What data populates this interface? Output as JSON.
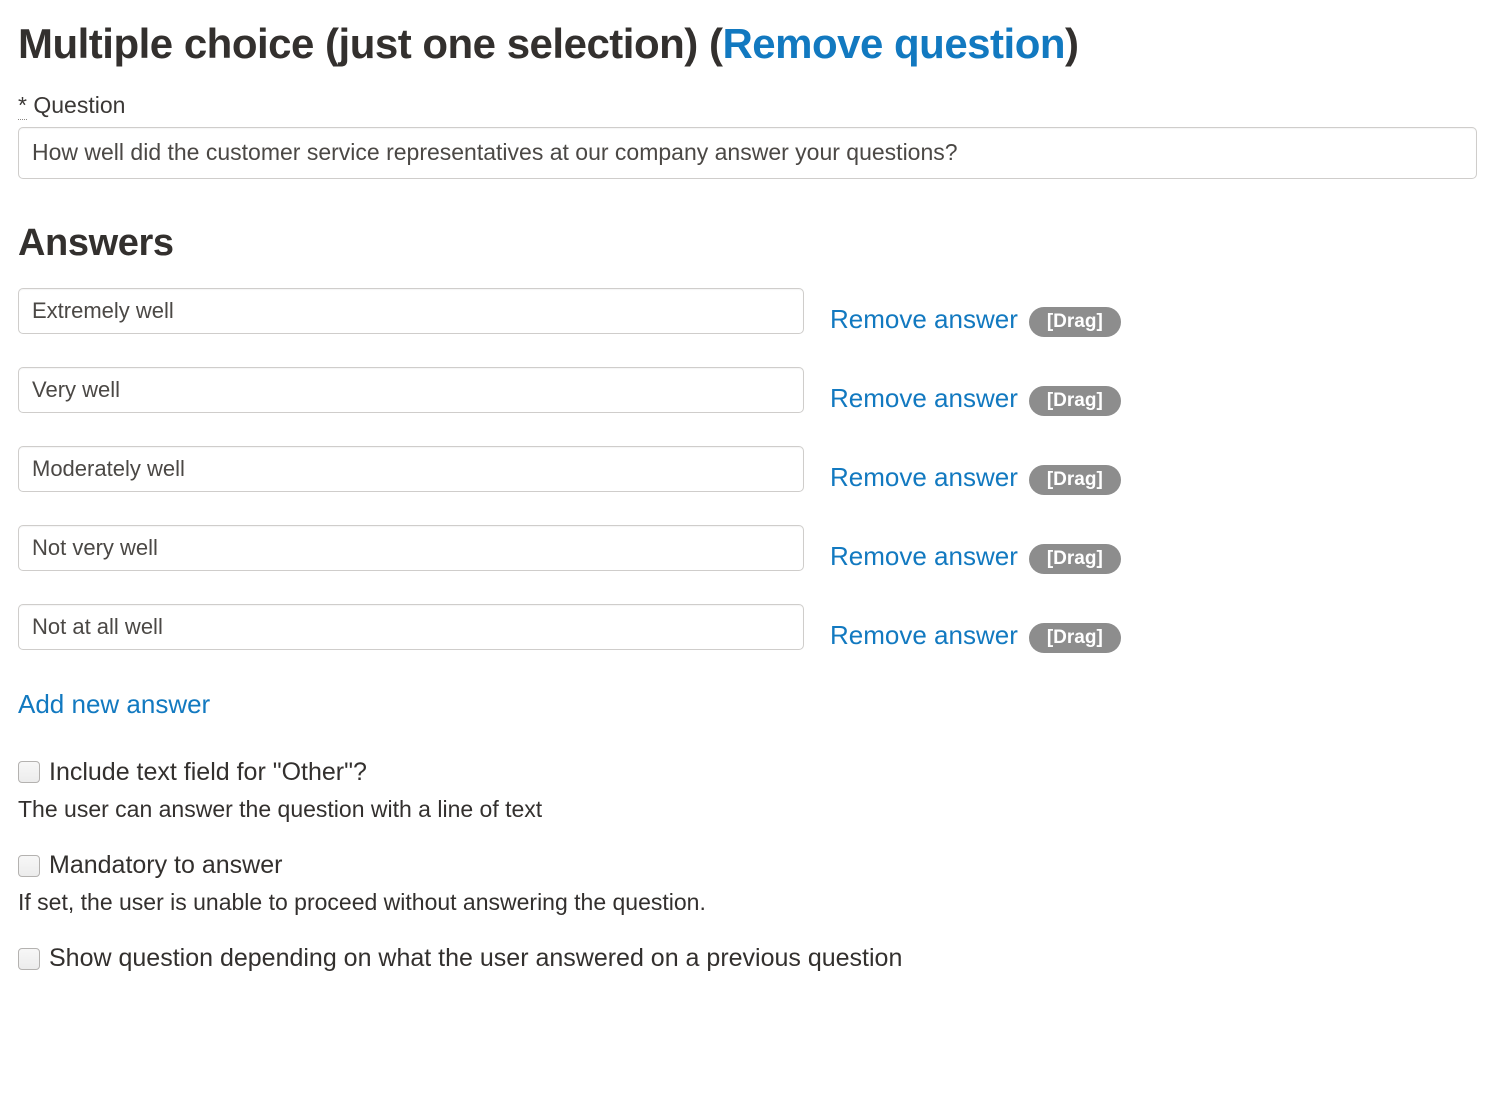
{
  "heading": {
    "title": "Multiple choice (just one selection)",
    "open_paren": "(",
    "remove_question_label": "Remove question",
    "close_paren": ")"
  },
  "question": {
    "required_mark": "*",
    "label": "Question",
    "value": "How well did the customer service representatives at our company answer your questions?",
    "placeholder": ""
  },
  "answers_section": {
    "heading": "Answers",
    "add_new_label": "Add new answer",
    "remove_answer_label": "Remove answer",
    "drag_label": "[Drag]",
    "items": [
      {
        "value": "Extremely well"
      },
      {
        "value": "Very well"
      },
      {
        "value": "Moderately well"
      },
      {
        "value": "Not very well"
      },
      {
        "value": "Not at all well"
      }
    ]
  },
  "options": [
    {
      "label": "Include text field for \"Other\"?",
      "help": "The user can answer the question with a line of text",
      "checked": false
    },
    {
      "label": "Mandatory to answer",
      "help": "If set, the user is unable to proceed without answering the question.",
      "checked": false
    },
    {
      "label": "Show question depending on what the user answered on a previous question",
      "help": "",
      "checked": false
    }
  ],
  "colors": {
    "link_blue": "#1279c0",
    "text": "#33302e",
    "input_border": "#cfcdcb",
    "drag_badge_bg": "#8d8d8d"
  }
}
